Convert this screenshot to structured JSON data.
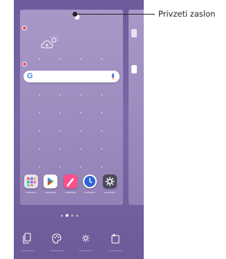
{
  "callout": {
    "label": "Privzeti zaslon"
  },
  "home_screen": {
    "search_bar": {
      "logo": "G",
      "mic_icon": "mic-icon"
    },
    "weather_widget_icon": "weather-cloud-sun-icon",
    "home_marker_icon": "home-icon",
    "dock_apps": [
      {
        "name": "apps-folder",
        "color": "#e7e2f1"
      },
      {
        "name": "play-store",
        "color": "#ffffff"
      },
      {
        "name": "notes",
        "color": "#ff4f8b"
      },
      {
        "name": "clock",
        "color": "#ffffff"
      },
      {
        "name": "settings",
        "color": "#4a4a5a"
      }
    ],
    "page_indicator": {
      "count": 4,
      "active_index": 1
    }
  },
  "bottom_bar": {
    "icons": [
      "wallpaper-icon",
      "theme-icon",
      "settings-icon",
      "widgets-icon"
    ]
  },
  "colors": {
    "background": "#6f5a9c",
    "panel": "#a898c8",
    "remove_badge": "#e84a6a",
    "callout": "#222222"
  }
}
